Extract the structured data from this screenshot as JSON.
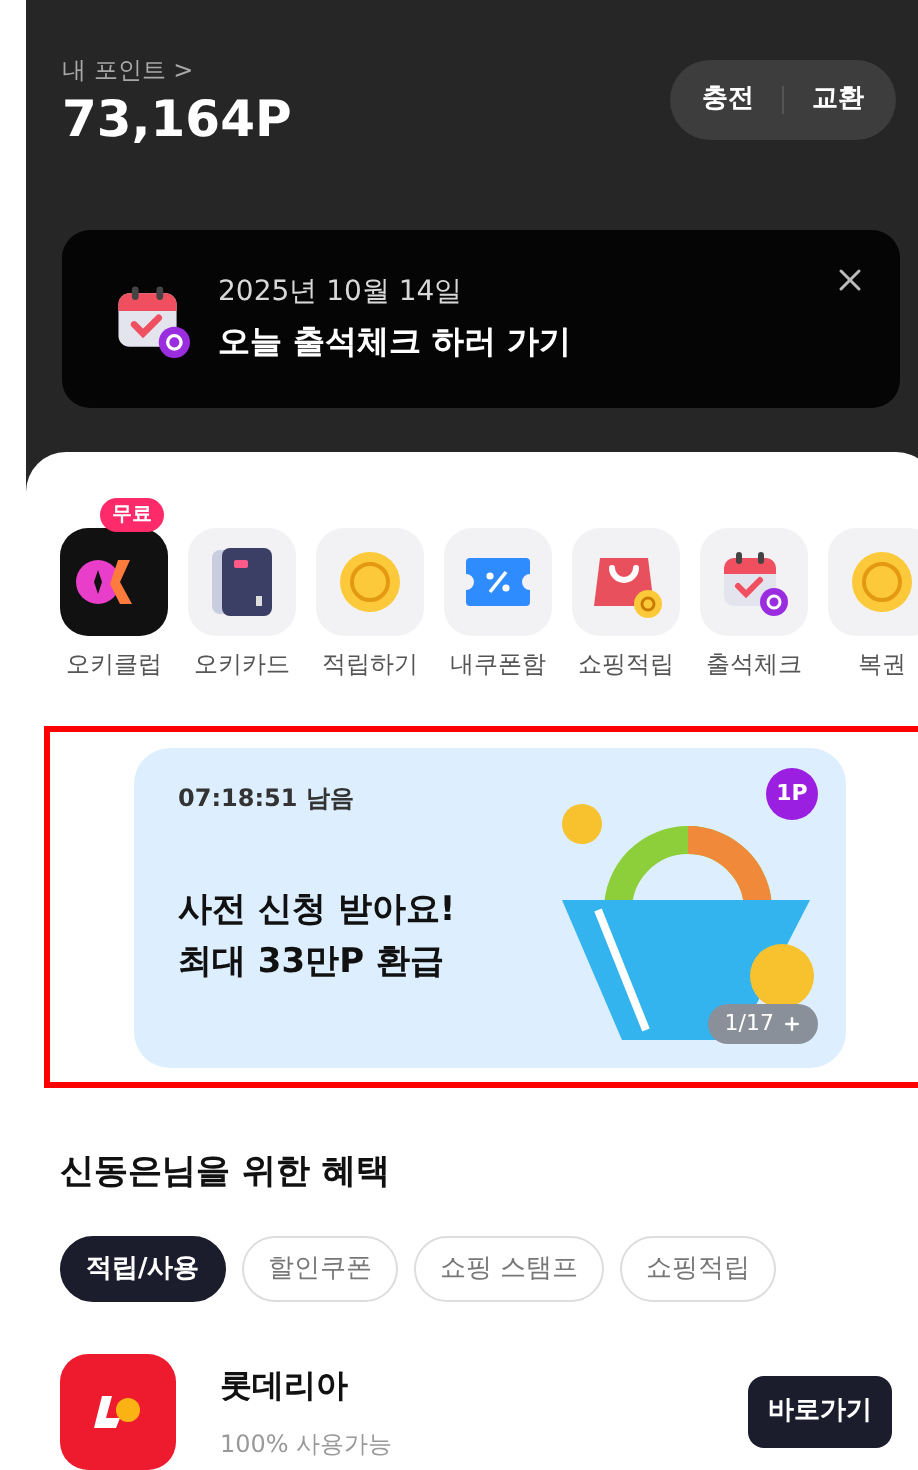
{
  "points": {
    "label": "내 포인트 >",
    "amount": "73,164P",
    "actions": [
      "충전",
      "교환"
    ]
  },
  "attendance": {
    "date": "2025년 10월 14일",
    "title": "오늘 출석체크 하러 가기"
  },
  "shortcuts": [
    {
      "kind": "club",
      "label": "오키클럽",
      "badge": "무료"
    },
    {
      "kind": "card",
      "label": "오키카드"
    },
    {
      "kind": "coin",
      "label": "적립하기"
    },
    {
      "kind": "coupon",
      "label": "내쿠폰함"
    },
    {
      "kind": "bag",
      "label": "쇼핑적립"
    },
    {
      "kind": "calendar",
      "label": "출석체크"
    },
    {
      "kind": "coin",
      "label": "복권"
    }
  ],
  "promo": {
    "timer": "07:18:51 남음",
    "lines": [
      "사전 신청 받아요!",
      "최대 33만P 환급"
    ],
    "badge": "1P",
    "pager": "1/17"
  },
  "benefits": {
    "title": "신동은님을 위한 혜택",
    "chips": [
      {
        "label": "적립/사용",
        "selected": true
      },
      {
        "label": "할인쿠폰",
        "selected": false
      },
      {
        "label": "쇼핑 스탬프",
        "selected": false
      },
      {
        "label": "쇼핑적립",
        "selected": false
      }
    ],
    "store": {
      "name": "롯데리아",
      "note": "100% 사용가능",
      "button": "바로가기"
    }
  }
}
